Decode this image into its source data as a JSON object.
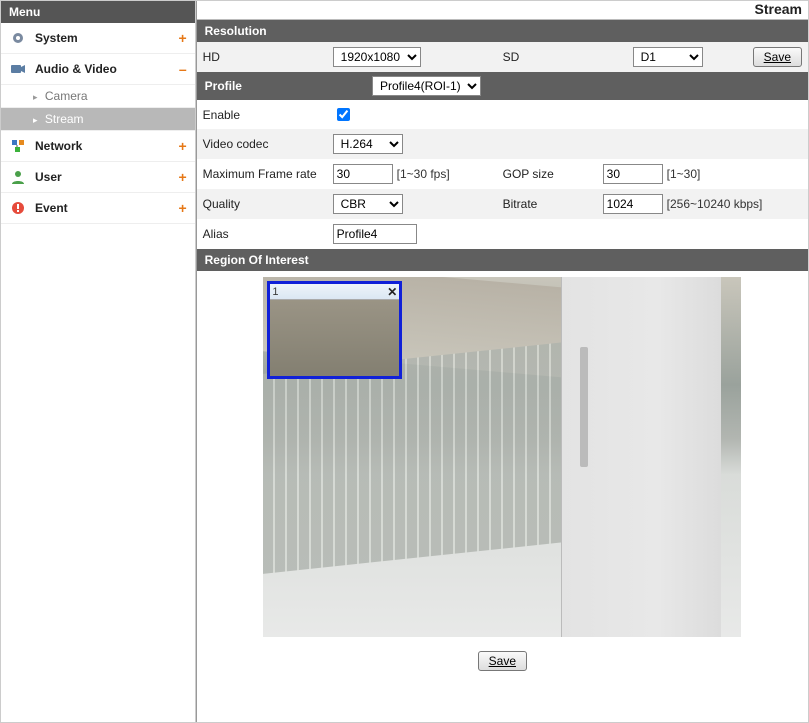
{
  "sidebar": {
    "title": "Menu",
    "items": [
      {
        "label": "System",
        "toggle": "+"
      },
      {
        "label": "Audio & Video",
        "toggle": "–"
      },
      {
        "label": "Network",
        "toggle": "+"
      },
      {
        "label": "User",
        "toggle": "+"
      },
      {
        "label": "Event",
        "toggle": "+"
      }
    ],
    "sub": [
      {
        "label": "Camera"
      },
      {
        "label": "Stream"
      }
    ]
  },
  "page": {
    "title": "Stream"
  },
  "resolution": {
    "header": "Resolution",
    "hd_label": "HD",
    "hd_value": "1920x1080",
    "sd_label": "SD",
    "sd_value": "D1",
    "save": "Save"
  },
  "profile": {
    "header": "Profile",
    "value": "Profile4(ROI-1)",
    "enable_label": "Enable",
    "enable_checked": true,
    "codec_label": "Video codec",
    "codec_value": "H.264",
    "fps_label": "Maximum Frame rate",
    "fps_value": "30",
    "fps_hint": "[1~30 fps]",
    "gop_label": "GOP size",
    "gop_value": "30",
    "gop_hint": "[1~30]",
    "quality_label": "Quality",
    "quality_value": "CBR",
    "bitrate_label": "Bitrate",
    "bitrate_value": "1024",
    "bitrate_hint": "[256~10240 kbps]",
    "alias_label": "Alias",
    "alias_value": "Profile4"
  },
  "roi": {
    "header": "Region Of Interest",
    "box_number": "1",
    "close_glyph": "✕"
  },
  "footer": {
    "save": "Save"
  }
}
